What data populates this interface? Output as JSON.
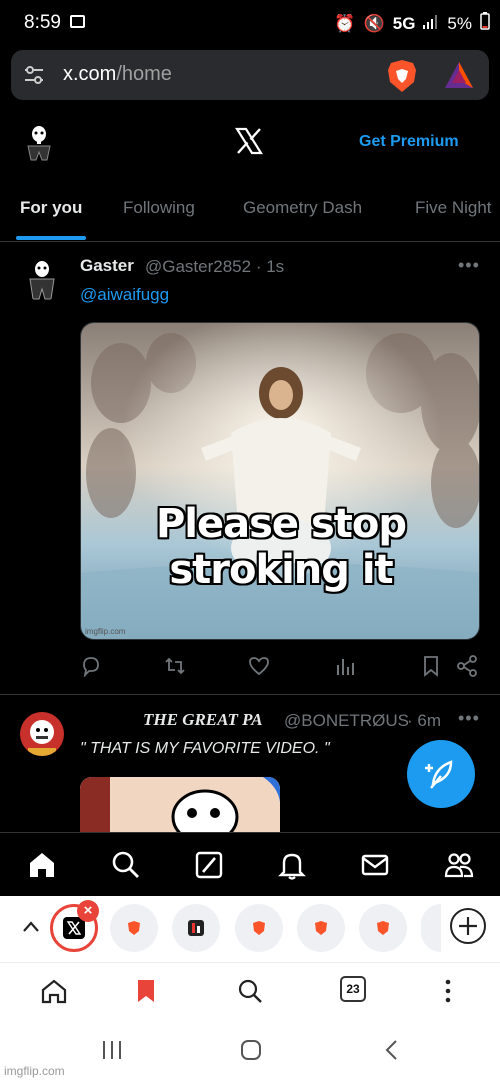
{
  "status_bar": {
    "time": "8:59",
    "network": "5G",
    "battery": "5%"
  },
  "browser": {
    "url_domain": "x.com",
    "url_path": "/home",
    "tab_count": "23",
    "icons": [
      "tune-icon",
      "brave-shield-icon",
      "brave-rewards-icon"
    ]
  },
  "x_header": {
    "get_premium": "Get Premium"
  },
  "tabs": [
    {
      "label": "For you",
      "active": true
    },
    {
      "label": "Following",
      "active": false
    },
    {
      "label": "Geometry Dash",
      "active": false
    },
    {
      "label": "Five Night",
      "active": false
    }
  ],
  "tweets": [
    {
      "name": "Gaster",
      "handle": "@Gaster2852 · 1s",
      "mention": "@aiwaifugg",
      "media_caption": "Please stop stroking it",
      "media_watermark": "imgflip.com"
    },
    {
      "name": "THE GREAT PA",
      "handle": "@BONETRØUS",
      "time": "· 6m",
      "text": "\" THAT IS MY FAVORITE VIDEO. \""
    }
  ],
  "more_glyph": "•••",
  "watermark": "imgflip.com",
  "colors": {
    "accent": "#1d9bf0",
    "background": "#000000",
    "muted": "#71767b"
  }
}
